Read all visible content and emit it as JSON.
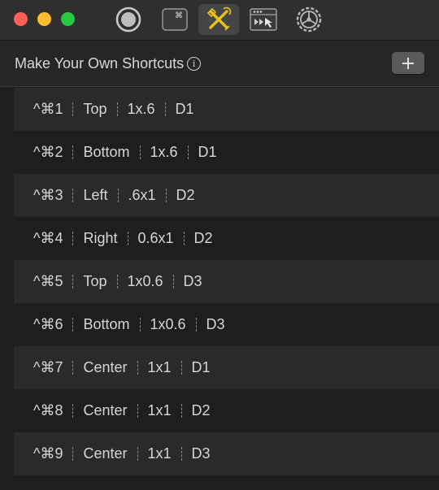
{
  "toolbar": {
    "icons": [
      "record-icon",
      "command-key-icon",
      "tools-icon",
      "window-arrange-icon",
      "settings-gear-icon"
    ],
    "command_glyph": "⌘"
  },
  "header": {
    "title": "Make Your Own Shortcuts",
    "info_glyph": "i",
    "add_glyph": "+"
  },
  "shortcuts": [
    {
      "keys": "^⌘1",
      "position": "Top",
      "size": "1x.6",
      "display": "D1"
    },
    {
      "keys": "^⌘2",
      "position": "Bottom",
      "size": "1x.6",
      "display": "D1"
    },
    {
      "keys": "^⌘3",
      "position": "Left",
      "size": ".6x1",
      "display": "D2"
    },
    {
      "keys": "^⌘4",
      "position": "Right",
      "size": "0.6x1",
      "display": "D2"
    },
    {
      "keys": "^⌘5",
      "position": "Top",
      "size": "1x0.6",
      "display": "D3"
    },
    {
      "keys": "^⌘6",
      "position": "Bottom",
      "size": "1x0.6",
      "display": "D3"
    },
    {
      "keys": "^⌘7",
      "position": "Center",
      "size": "1x1",
      "display": "D1"
    },
    {
      "keys": "^⌘8",
      "position": "Center",
      "size": "1x1",
      "display": "D2"
    },
    {
      "keys": "^⌘9",
      "position": "Center",
      "size": "1x1",
      "display": "D3"
    }
  ],
  "colors": {
    "window_bg": "#1e1e1e",
    "alt_row_bg": "#2a2a2a",
    "selected_tab_bg": "#454545",
    "tools_icon": "#e8c21b"
  }
}
